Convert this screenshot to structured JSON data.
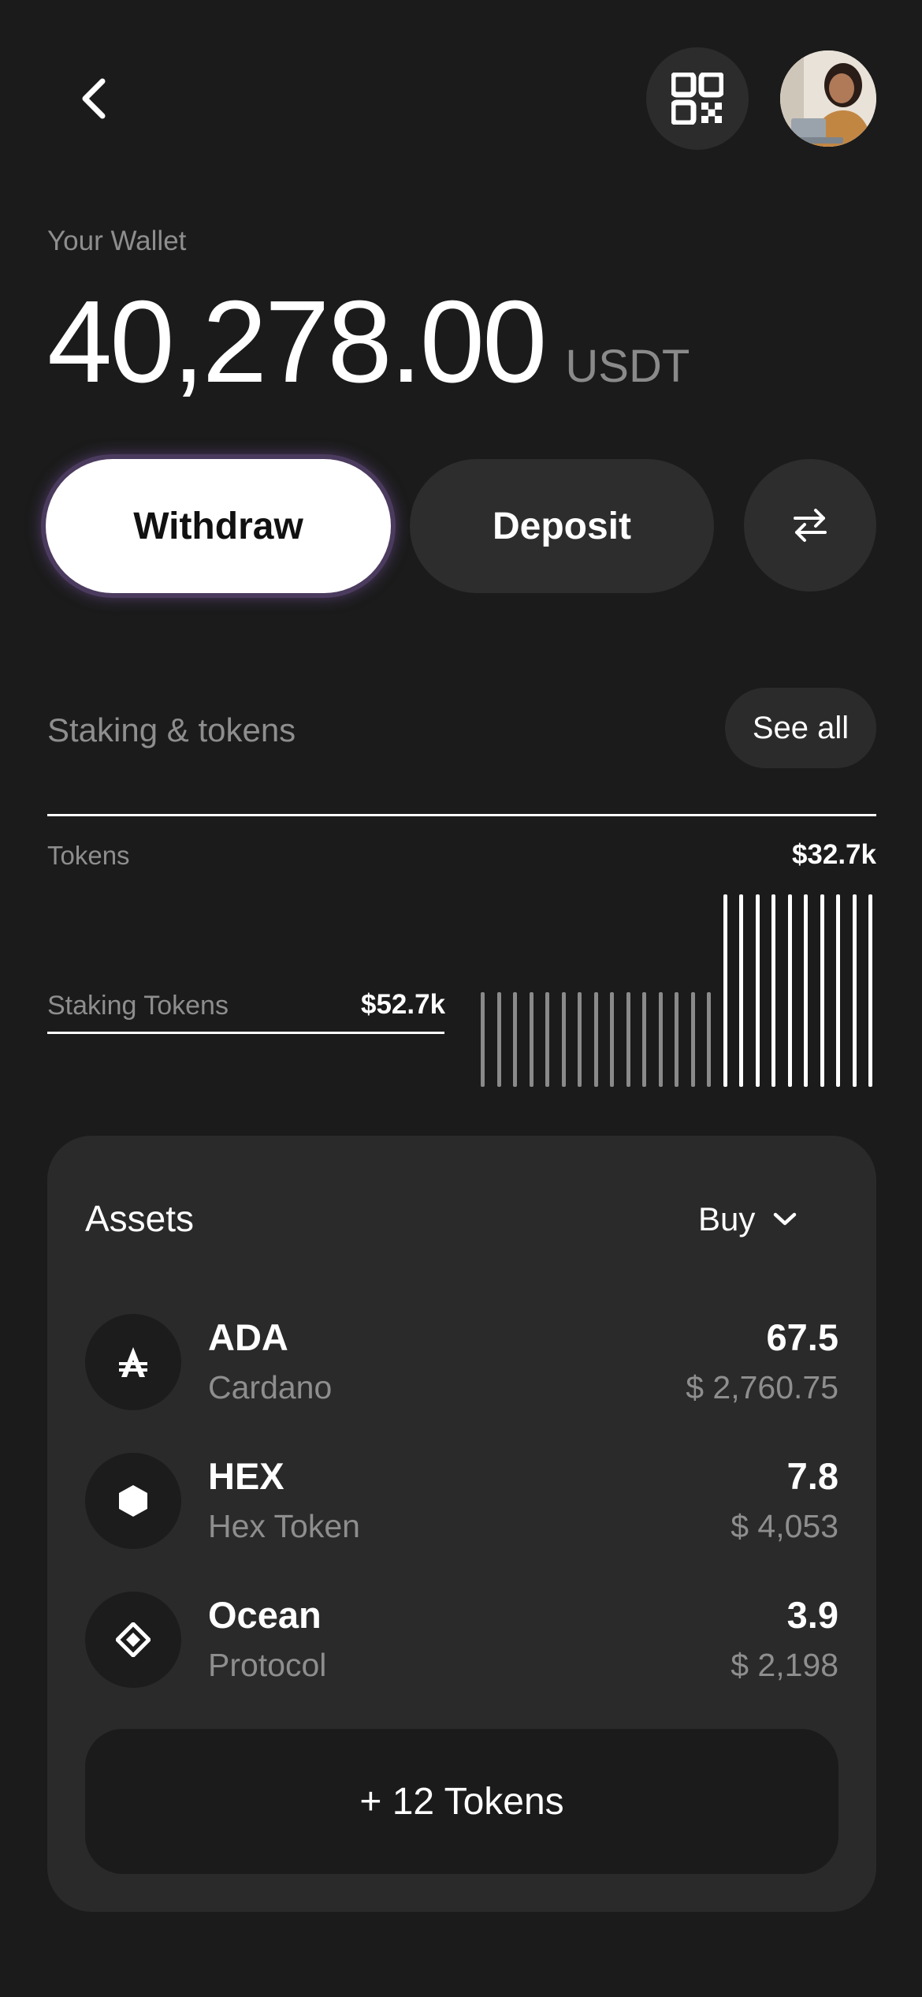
{
  "header": {
    "back_icon": "chevron-left-icon",
    "qr_icon": "qr-code-icon",
    "avatar": "user-avatar"
  },
  "wallet": {
    "label": "Your Wallet",
    "balance": "40,278.00",
    "currency": "USDT"
  },
  "actions": {
    "withdraw_label": "Withdraw",
    "deposit_label": "Deposit",
    "swap_icon": "swap-arrows-icon"
  },
  "staking": {
    "title": "Staking & tokens",
    "see_all_label": "See all",
    "tokens_label": "Tokens",
    "tokens_value": "$32.7k",
    "staking_label": "Staking Tokens",
    "staking_value": "$52.7k",
    "bars": {
      "dim_count": 15,
      "bright_count": 10,
      "dim_level": 0.49,
      "bright_level": 1.0,
      "dim_color": "#8a8a8a",
      "bright_color": "#ffffff"
    }
  },
  "assets": {
    "title": "Assets",
    "filter_value": "Buy",
    "items": [
      {
        "symbol": "ADA",
        "name": "Cardano",
        "amount": "67.5",
        "usd": "$ 2,760.75",
        "icon": "ada-icon"
      },
      {
        "symbol": "HEX",
        "name": "Hex Token",
        "amount": "7.8",
        "usd": "$ 4,053",
        "icon": "hexagon-icon"
      },
      {
        "symbol": "Ocean",
        "name": "Protocol",
        "amount": "3.9",
        "usd": "$ 2,198",
        "icon": "diamond-icon"
      }
    ],
    "more_label": "+ 12 Tokens"
  },
  "colors": {
    "background": "#1b1b1b",
    "card": "#2a2a2a",
    "muted_text": "#8e8e8e",
    "accent_glow": "#4b3b5e"
  }
}
